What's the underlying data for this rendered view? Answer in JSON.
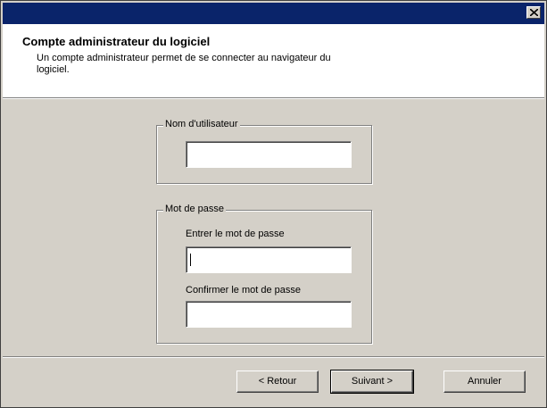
{
  "window": {
    "close_icon": "close-icon"
  },
  "header": {
    "title": "Compte administrateur du logiciel",
    "description": "Un compte administrateur permet de se connecter au navigateur du logiciel."
  },
  "username_group": {
    "legend": "Nom d'utilisateur",
    "value": ""
  },
  "password_group": {
    "legend": "Mot de passe",
    "enter_label": "Entrer le mot de passe",
    "enter_value": "",
    "confirm_label": "Confirmer le mot de passe",
    "confirm_value": ""
  },
  "buttons": {
    "back_label": "< Retour",
    "next_label": "Suivant >",
    "cancel_label": "Annuler"
  },
  "colors": {
    "titlebar": "#0a246a",
    "dialog_face": "#d4d0c8",
    "header_bg": "#ffffff"
  }
}
